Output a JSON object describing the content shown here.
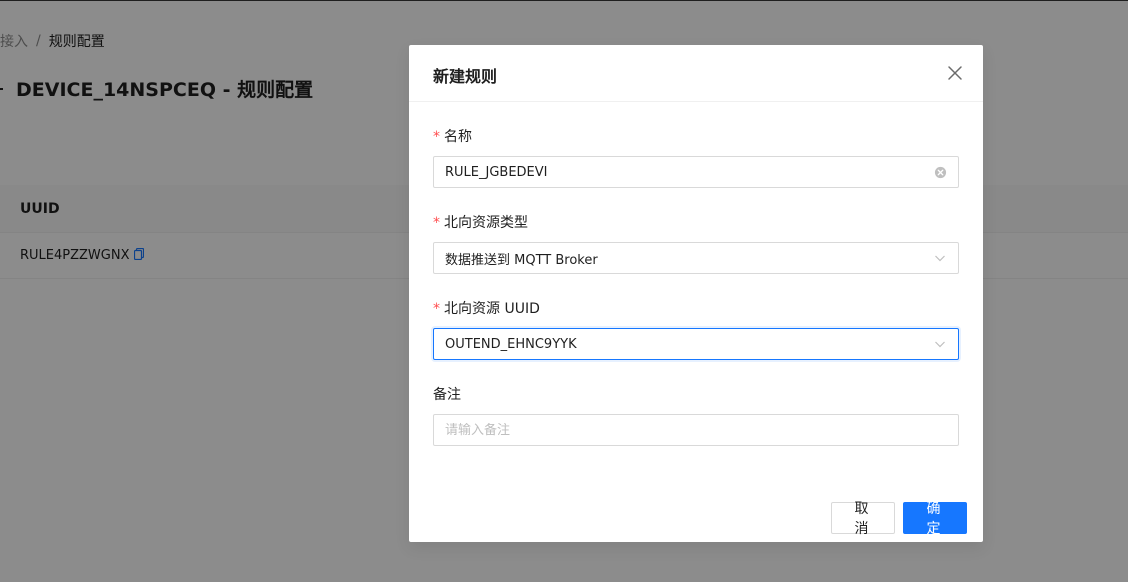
{
  "background": {
    "breadcrumb": {
      "previous": "备接入",
      "separator": "/",
      "current": "规则配置"
    },
    "page_title": "DEVICE_14NSPCEQ - 规则配置",
    "table": {
      "columns": [
        "UUID"
      ],
      "rows": [
        {
          "uuid": "RULE4PZZWGNX"
        }
      ]
    }
  },
  "modal": {
    "title": "新建规则",
    "fields": {
      "name": {
        "label": "名称",
        "required": true,
        "value": "RULE_JGBEDEVI"
      },
      "resource_type": {
        "label": "北向资源类型",
        "required": true,
        "value": "数据推送到 MQTT Broker"
      },
      "resource_uuid": {
        "label": "北向资源 UUID",
        "required": true,
        "value": "OUTEND_EHNC9YYK"
      },
      "remark": {
        "label": "备注",
        "required": false,
        "placeholder": "请输入备注"
      }
    },
    "footer": {
      "cancel_label": "取消",
      "ok_label": "确定"
    }
  },
  "icons": {
    "close": "close-icon",
    "clear": "clear-circle-icon",
    "chevron": "chevron-down-icon",
    "copy": "copy-icon",
    "back": "back-arrow-icon"
  },
  "colors": {
    "primary": "#1677ff",
    "required": "#ff4d4f",
    "overlay": "rgba(0,0,0,0.45)"
  }
}
